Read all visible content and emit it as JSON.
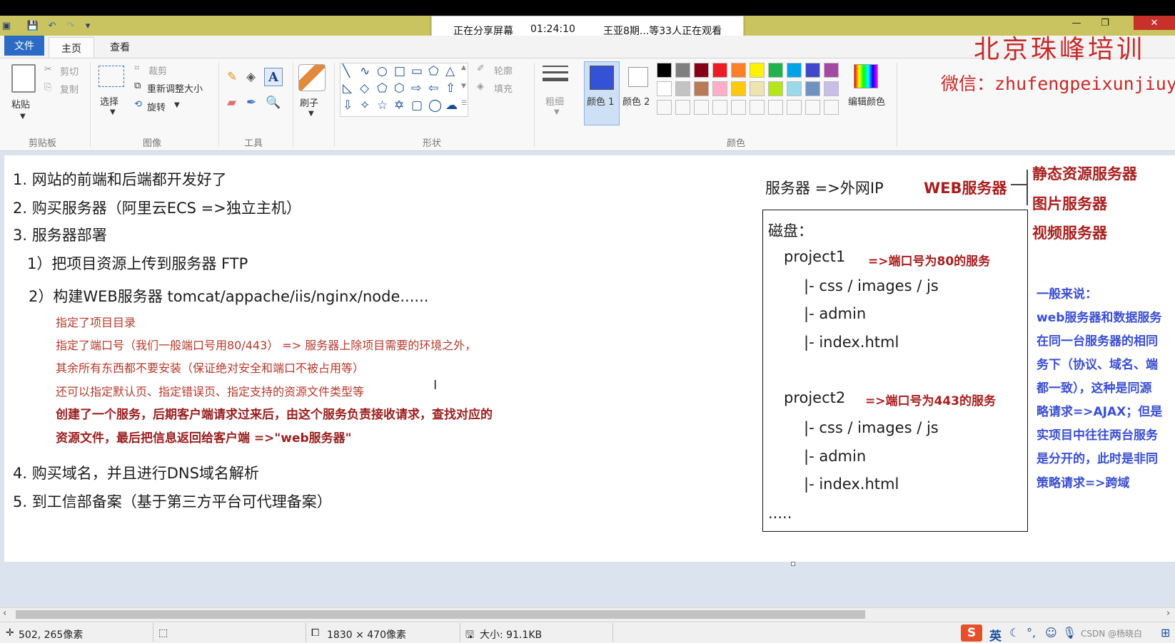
{
  "share_banner": {
    "status": "正在分享屏幕",
    "time": "01:24:10",
    "viewers": "王亚8期...等33人正在观看"
  },
  "ribbon": {
    "tabs": [
      "文件",
      "主页",
      "查看"
    ],
    "clipboard": {
      "paste": "粘贴",
      "cut": "剪切",
      "copy": "复制",
      "group": "剪贴板"
    },
    "image": {
      "select": "选择",
      "crop": "裁剪",
      "resize": "重新调整大小",
      "rotate": "旋转",
      "group": "图像"
    },
    "tools": {
      "group": "工具",
      "text_glyph": "A"
    },
    "brush": {
      "label": "刷子"
    },
    "shapes": {
      "outline": "轮廓",
      "fill": "填充",
      "group": "形状"
    },
    "size": {
      "label": "粗细"
    },
    "colors": {
      "color1": "颜色 1",
      "color2": "颜色 2",
      "edit": "编辑颜色",
      "group": "颜色",
      "primary": "#3352d6",
      "row1": [
        "#000000",
        "#7f7f7f",
        "#880015",
        "#ed1c24",
        "#ff7f27",
        "#fff200",
        "#22b14c",
        "#00a2e8",
        "#3f48cc",
        "#a349a4"
      ],
      "row2": [
        "#ffffff",
        "#c3c3c3",
        "#b97a57",
        "#ffaec9",
        "#ffc90e",
        "#efe4b0",
        "#b5e61d",
        "#99d9ea",
        "#7092be",
        "#c8bfe7"
      ]
    }
  },
  "logo": {
    "title": "北京珠峰培训",
    "wechat": "微信：zhufengpeixunjiuye"
  },
  "notes": {
    "l1": "1. 网站的前端和后端都开发好了",
    "l2": "2. 购买服务器（阿里云ECS =>独立主机）",
    "l3": "3. 服务器部署",
    "l3a": "1）把项目资源上传到服务器 FTP",
    "l3b": "2）构建WEB服务器  tomcat/appache/iis/nginx/node......",
    "s1": "指定了项目目录",
    "s2": "指定了端口号（我们一般端口号用80/443） => 服务器上除项目需要的环境之外，",
    "s3": "其余所有东西都不要安装（保证绝对安全和端口不被占用等）",
    "s4": "还可以指定默认页、指定错误页、指定支持的资源文件类型等",
    "s5": "创建了一个服务，后期客户端请求过来后，由这个服务负责接收请求，查找对应的",
    "s6": "资源文件，最后把信息返回给客户端 =>\"web服务器\"",
    "l4": "4. 购买域名，并且进行DNS域名解析",
    "l5": "5. 到工信部备案（基于第三方平台可代理备案）"
  },
  "diagram": {
    "server": "服务器  =>外网IP",
    "web_server": "WEB服务器",
    "branches": [
      "静态资源服务器",
      "图片服务器",
      "视频服务器"
    ],
    "disk": "磁盘：",
    "p1": "project1",
    "p1_note": "=>端口号为80的服务",
    "p1_items": [
      "|- css / images / js",
      "|- admin",
      "|- index.html"
    ],
    "p2": "project2",
    "p2_note": "=>端口号为443的服务",
    "p2_items": [
      "|- css / images / js",
      "|- admin",
      "|- index.html"
    ],
    "more": "....."
  },
  "side_note": [
    "一般来说：",
    "  web服务器和数据服务",
    "在同一台服务器的相同",
    "务下（协议、域名、端",
    "都一致），这种是同源",
    "略请求=>AJAX；但是",
    "实项目中往往两台服务",
    "是分开的，此时是非同",
    "策略请求=>跨域"
  ],
  "status": {
    "cursor_pos": "502, 265像素",
    "canvas_size": "1830 × 470像素",
    "file_size": "大小: 91.1KB",
    "ime": "英",
    "watermark": "CSDN @杨晓白"
  }
}
